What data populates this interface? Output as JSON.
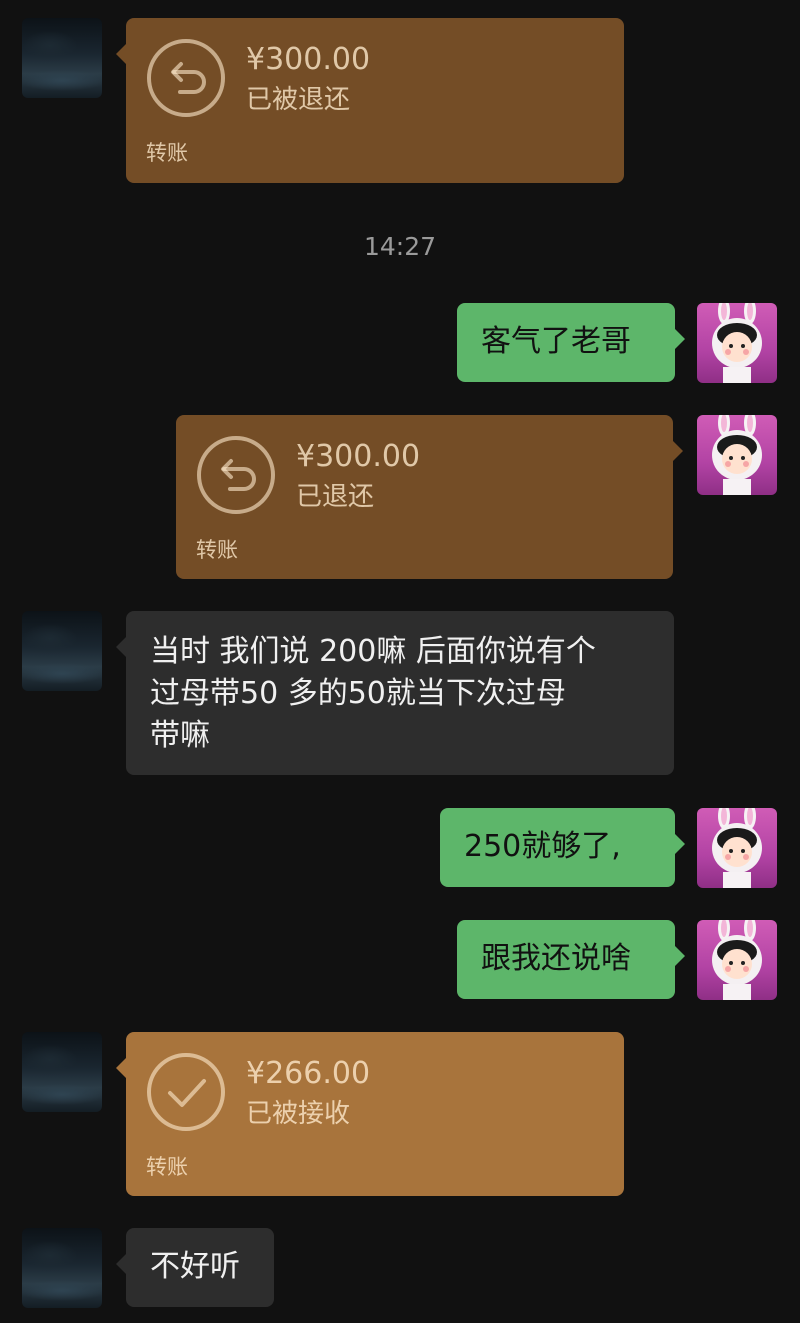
{
  "colors": {
    "background": "#111111",
    "transfer_returned": "#744d26",
    "transfer_received": "#a8743c",
    "bubble_self": "#5db66a",
    "bubble_other": "#2d2d2d"
  },
  "timestamp": "14:27",
  "messages": [
    {
      "type": "transfer",
      "side": "left",
      "amount": "¥300.00",
      "status": "已被退还",
      "label": "转账",
      "icon": "return-arrow-icon"
    },
    {
      "type": "text",
      "side": "right",
      "text": "客气了老哥"
    },
    {
      "type": "transfer",
      "side": "right",
      "amount": "¥300.00",
      "status": "已退还",
      "label": "转账",
      "icon": "return-arrow-icon"
    },
    {
      "type": "text",
      "side": "left",
      "lines": [
        "当时 我们说 200嘛 后面你说有个",
        "过母带50 多的50就当下次过母",
        "带嘛"
      ]
    },
    {
      "type": "text",
      "side": "right",
      "text": "250就够了,"
    },
    {
      "type": "text",
      "side": "right",
      "text": "跟我还说啥"
    },
    {
      "type": "transfer",
      "side": "left",
      "amount": "¥266.00",
      "status": "已被接收",
      "label": "转账",
      "icon": "checkmark-icon"
    },
    {
      "type": "text",
      "side": "left",
      "text": "不好听"
    }
  ]
}
